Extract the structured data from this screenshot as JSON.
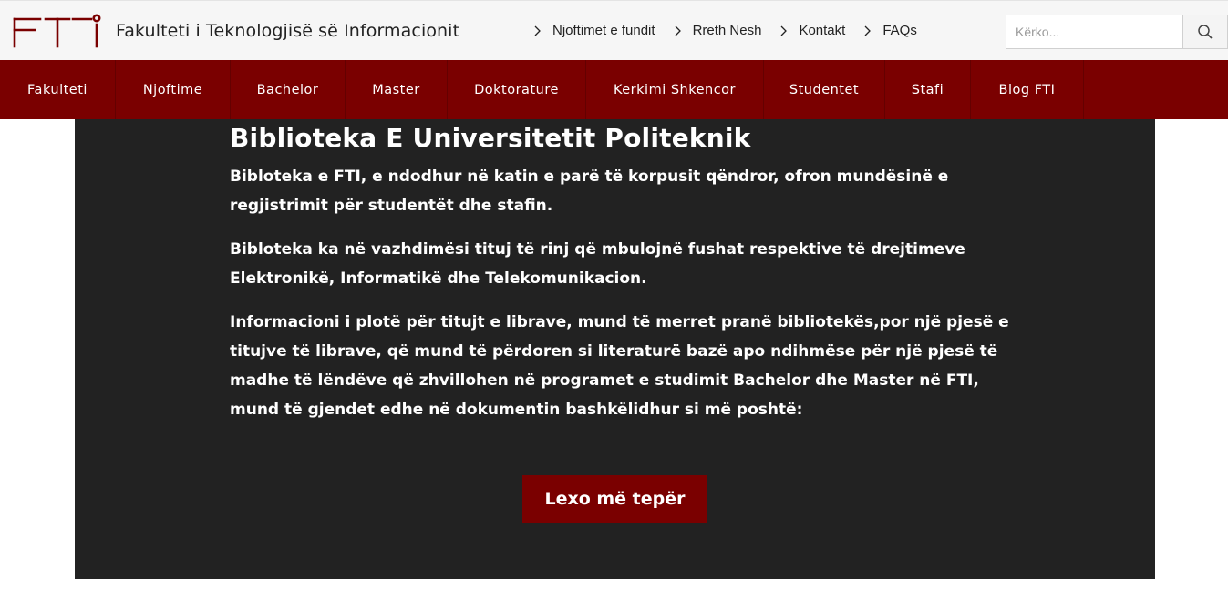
{
  "header": {
    "site_title": "Fakulteti i Teknologjisë së Informacionit",
    "logo_text": "FTI",
    "links": [
      {
        "label": "Njoftimet e fundit"
      },
      {
        "label": "Rreth Nesh"
      },
      {
        "label": "Kontakt"
      },
      {
        "label": "FAQs"
      }
    ],
    "search": {
      "placeholder": "Kërko...",
      "value": ""
    }
  },
  "nav": {
    "items": [
      {
        "label": "Fakulteti"
      },
      {
        "label": "Njoftime"
      },
      {
        "label": "Bachelor"
      },
      {
        "label": "Master"
      },
      {
        "label": "Doktorature"
      },
      {
        "label": "Kerkimi Shkencor"
      },
      {
        "label": "Studentet"
      },
      {
        "label": "Stafi"
      },
      {
        "label": "Blog FTI"
      }
    ]
  },
  "main": {
    "title": "Biblioteka E Universitetit Politeknik",
    "paragraphs": [
      "Bibloteka e FTI, e ndodhur në katin e parë të korpusit qëndror, ofron mundësinë e regjistrimit për studentët dhe stafin.",
      "Bibloteka ka në vazhdimësi tituj të rinj që mbulojnë fushat respektive të drejtimeve Elektronikë, Informatikë dhe Telekomunikacion.",
      "Informacioni i plotë për titujt e librave, mund të merret pranë bibliotekës,por një pjesë e titujve të librave, që mund të përdoren si literaturë bazë apo ndihmëse për një pjesë të madhe të lëndëve që zhvillohen në programet e studimit Bachelor dhe Master në FTI, mund të gjendet edhe në dokumentin bashkëlidhur si më poshtë:"
    ],
    "read_more": "Lexo më tepër"
  },
  "colors": {
    "brand": "#7a0000",
    "panel": "#222222",
    "topbar": "#f6f6f6"
  }
}
